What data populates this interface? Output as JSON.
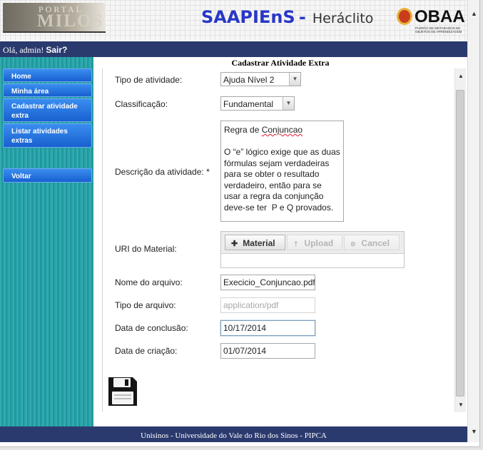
{
  "header": {
    "portal_small": "PORTAL",
    "portal_big": "MILOS",
    "app_name": "SAAPIEnS",
    "separator": "-",
    "app_subtitle": "Heráclito",
    "obaa_name": "OBAA",
    "obaa_tagline": "PADRÃO DE METADADOS DE OBJETOS DE APRENDIZAGEM"
  },
  "topbar": {
    "greeting": "Olá, admin!",
    "logout": "Sair?"
  },
  "page_title": "Cadastrar Atividade Extra",
  "sidebar": {
    "items": [
      {
        "label": "Home"
      },
      {
        "label": "Minha área"
      },
      {
        "label": "Cadastrar atividade extra"
      },
      {
        "label": "Listar atividades extras"
      },
      {
        "label": "Voltar"
      }
    ]
  },
  "form": {
    "tipo_label": "Tipo de atividade:",
    "tipo_value": "Ajuda Nível 2",
    "classificacao_label": "Classificação:",
    "classificacao_value": "Fundamental",
    "descricao_label": "Descrição da atividade: *",
    "descricao_title_prefix": "Regra de ",
    "descricao_title_word": "Conjuncao",
    "descricao_body": "O “e” lógico exige que as duas fórmulas sejam verdadeiras para se obter o resultado verdadeiro, então para se usar a regra da conjunção deve-se ter  P e Q provados.",
    "uri_label": "URI do Material:",
    "material_button": "Material",
    "upload_button": "Upload",
    "cancel_button": "Cancel",
    "nome_label": "Nome do arquivo:",
    "nome_value": "Execicio_Conjuncao.pdf",
    "tipo_arquivo_label": "Tipo de arquivo:",
    "tipo_arquivo_value": "application/pdf",
    "conclusao_label": "Data de conclusão:",
    "conclusao_value": "10/17/2014",
    "criacao_label": "Data de criação:",
    "criacao_value": "01/07/2014"
  },
  "footer": {
    "text": "Unisinos - Universidade do Vale do Rio dos Sinos - PIPCA"
  },
  "colors": {
    "navy_bar": "#2b3a6e",
    "sidebar_teal": "#1fa0a6",
    "nav_blue": "#2a78e4",
    "title_blue": "#2837c6"
  },
  "icons": [
    "save-disk-icon",
    "plus-icon",
    "upload-arrow-icon",
    "cancel-icon",
    "scroll-up-icon",
    "scroll-down-icon",
    "dropdown-arrow-icon"
  ]
}
